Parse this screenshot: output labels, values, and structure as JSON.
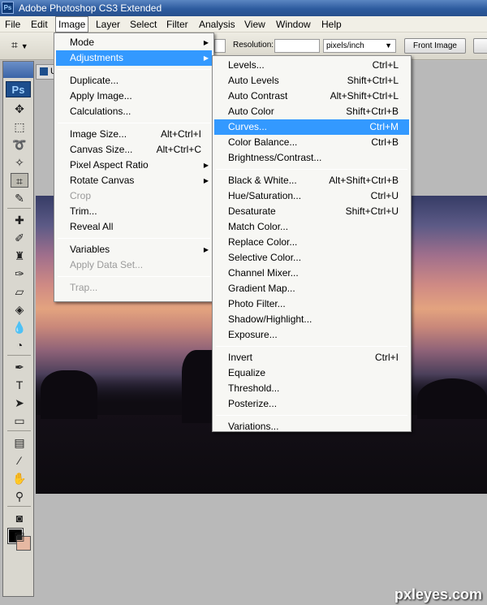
{
  "title_bar": {
    "icon": "Ps",
    "title": "Adobe Photoshop CS3 Extended"
  },
  "menubar": [
    "File",
    "Edit",
    "Image",
    "Layer",
    "Select",
    "Filter",
    "Analysis",
    "View",
    "Window",
    "Help"
  ],
  "options_bar": {
    "resolution_label": "Resolution:",
    "resolution_value": "",
    "unit": "pixels/inch",
    "front_image_label": "Front Image"
  },
  "document_tab": {
    "label": "U"
  },
  "toolbox": {
    "logo": "Ps",
    "tools": [
      {
        "name": "move-tool-icon",
        "glyph": "✥"
      },
      {
        "name": "marquee-tool-icon",
        "glyph": "⬚"
      },
      {
        "name": "lasso-tool-icon",
        "glyph": "➰"
      },
      {
        "name": "magic-wand-tool-icon",
        "glyph": "✧"
      },
      {
        "name": "crop-tool-icon",
        "glyph": "⌗"
      },
      {
        "name": "eyedropper-tool-icon",
        "glyph": "✎"
      },
      {
        "name": "healing-brush-tool-icon",
        "glyph": "✚"
      },
      {
        "name": "brush-tool-icon",
        "glyph": "✐"
      },
      {
        "name": "clone-stamp-tool-icon",
        "glyph": "♜"
      },
      {
        "name": "history-brush-tool-icon",
        "glyph": "✑"
      },
      {
        "name": "eraser-tool-icon",
        "glyph": "▱"
      },
      {
        "name": "paint-bucket-tool-icon",
        "glyph": "◈"
      },
      {
        "name": "blur-tool-icon",
        "glyph": "💧"
      },
      {
        "name": "dodge-tool-icon",
        "glyph": "◔"
      },
      {
        "name": "pen-tool-icon",
        "glyph": "✒"
      },
      {
        "name": "type-tool-icon",
        "glyph": "T"
      },
      {
        "name": "path-selection-tool-icon",
        "glyph": "➤"
      },
      {
        "name": "shape-tool-icon",
        "glyph": "▭"
      },
      {
        "name": "notes-tool-icon",
        "glyph": "▤"
      },
      {
        "name": "color-sampler-tool-icon",
        "glyph": "⁄"
      },
      {
        "name": "hand-tool-icon",
        "glyph": "✋"
      },
      {
        "name": "zoom-tool-icon",
        "glyph": "⚲"
      },
      {
        "name": "quick-mask-icon",
        "glyph": "◙"
      },
      {
        "name": "screen-mode-icon",
        "glyph": "▣"
      }
    ]
  },
  "image_menu": {
    "items": [
      {
        "label": "Mode",
        "shortcut": "",
        "submenu": true,
        "disabled": false
      },
      {
        "label": "Adjustments",
        "shortcut": "",
        "submenu": true,
        "disabled": false,
        "highlight": true
      },
      {
        "sep": true
      },
      {
        "label": "Duplicate...",
        "shortcut": "",
        "submenu": false,
        "disabled": false
      },
      {
        "label": "Apply Image...",
        "shortcut": "",
        "submenu": false,
        "disabled": false
      },
      {
        "label": "Calculations...",
        "shortcut": "",
        "submenu": false,
        "disabled": false
      },
      {
        "sep": true
      },
      {
        "label": "Image Size...",
        "shortcut": "Alt+Ctrl+I",
        "submenu": false,
        "disabled": false
      },
      {
        "label": "Canvas Size...",
        "shortcut": "Alt+Ctrl+C",
        "submenu": false,
        "disabled": false
      },
      {
        "label": "Pixel Aspect Ratio",
        "shortcut": "",
        "submenu": true,
        "disabled": false
      },
      {
        "label": "Rotate Canvas",
        "shortcut": "",
        "submenu": true,
        "disabled": false
      },
      {
        "label": "Crop",
        "shortcut": "",
        "submenu": false,
        "disabled": true
      },
      {
        "label": "Trim...",
        "shortcut": "",
        "submenu": false,
        "disabled": false
      },
      {
        "label": "Reveal All",
        "shortcut": "",
        "submenu": false,
        "disabled": false
      },
      {
        "sep": true
      },
      {
        "label": "Variables",
        "shortcut": "",
        "submenu": true,
        "disabled": false
      },
      {
        "label": "Apply Data Set...",
        "shortcut": "",
        "submenu": false,
        "disabled": true
      },
      {
        "sep": true
      },
      {
        "label": "Trap...",
        "shortcut": "",
        "submenu": false,
        "disabled": true
      }
    ]
  },
  "adjustments_menu": {
    "items": [
      {
        "label": "Levels...",
        "shortcut": "Ctrl+L"
      },
      {
        "label": "Auto Levels",
        "shortcut": "Shift+Ctrl+L"
      },
      {
        "label": "Auto Contrast",
        "shortcut": "Alt+Shift+Ctrl+L"
      },
      {
        "label": "Auto Color",
        "shortcut": "Shift+Ctrl+B"
      },
      {
        "label": "Curves...",
        "shortcut": "Ctrl+M",
        "highlight": true
      },
      {
        "label": "Color Balance...",
        "shortcut": "Ctrl+B"
      },
      {
        "label": "Brightness/Contrast...",
        "shortcut": ""
      },
      {
        "sep": true
      },
      {
        "label": "Black & White...",
        "shortcut": "Alt+Shift+Ctrl+B"
      },
      {
        "label": "Hue/Saturation...",
        "shortcut": "Ctrl+U"
      },
      {
        "label": "Desaturate",
        "shortcut": "Shift+Ctrl+U"
      },
      {
        "label": "Match Color...",
        "shortcut": ""
      },
      {
        "label": "Replace Color...",
        "shortcut": ""
      },
      {
        "label": "Selective Color...",
        "shortcut": ""
      },
      {
        "label": "Channel Mixer...",
        "shortcut": ""
      },
      {
        "label": "Gradient Map...",
        "shortcut": ""
      },
      {
        "label": "Photo Filter...",
        "shortcut": ""
      },
      {
        "label": "Shadow/Highlight...",
        "shortcut": ""
      },
      {
        "label": "Exposure...",
        "shortcut": ""
      },
      {
        "sep": true
      },
      {
        "label": "Invert",
        "shortcut": "Ctrl+I"
      },
      {
        "label": "Equalize",
        "shortcut": ""
      },
      {
        "label": "Threshold...",
        "shortcut": ""
      },
      {
        "label": "Posterize...",
        "shortcut": ""
      },
      {
        "sep": true
      },
      {
        "label": "Variations...",
        "shortcut": ""
      }
    ]
  },
  "watermark": "pxleyes.com",
  "colors": {
    "highlight": "#3399ff",
    "foreground_color": "#000000",
    "background_color": "#e6b8a2"
  }
}
